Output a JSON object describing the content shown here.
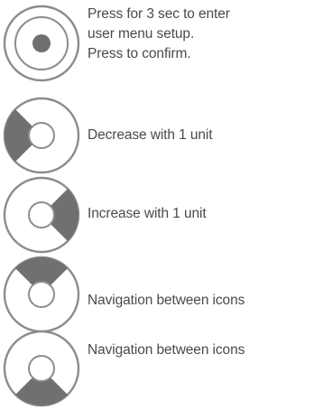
{
  "colors": {
    "ring": "#8c8c8c",
    "fill": "#707070",
    "text": "#4a4a4a"
  },
  "legend": {
    "items": [
      {
        "icon": "center-button-icon",
        "lines": [
          "Press for 3 sec to enter",
          "user menu setup.",
          "Press to confirm."
        ]
      },
      {
        "icon": "left-segment-icon",
        "lines": [
          "Decrease with 1 unit"
        ]
      },
      {
        "icon": "right-segment-icon",
        "lines": [
          "Increase with 1 unit"
        ]
      },
      {
        "icon": "top-segment-icon",
        "lines": [
          "Navigation between icons"
        ]
      },
      {
        "icon": "bottom-segment-icon",
        "lines": [
          "Navigation between icons"
        ]
      }
    ]
  }
}
